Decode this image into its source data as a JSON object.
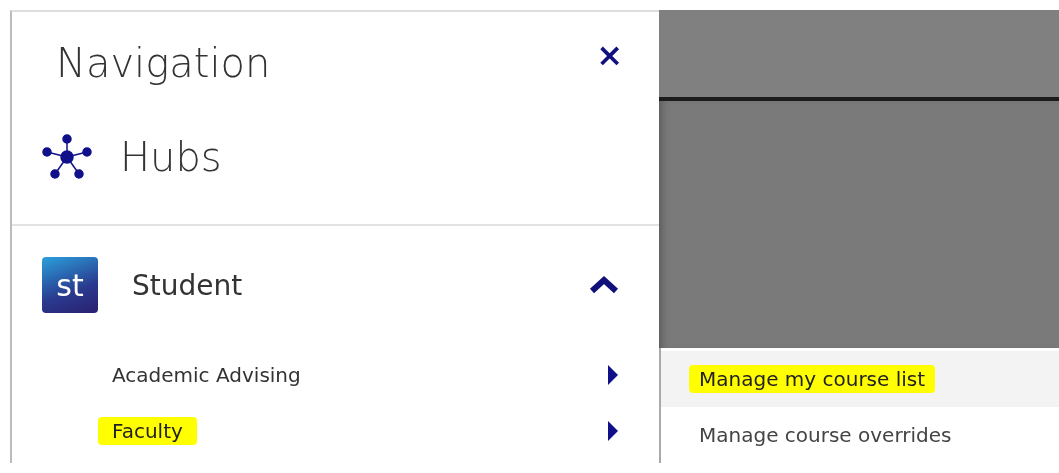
{
  "navigation": {
    "title": "Navigation",
    "close": "×",
    "hubs": {
      "label": "Hubs"
    },
    "section": {
      "badge": "st",
      "label": "Student",
      "expanded": true,
      "items": [
        {
          "label": "Academic Advising",
          "highlighted": false
        },
        {
          "label": "Faculty",
          "highlighted": true
        }
      ]
    }
  },
  "submenu": {
    "items": [
      {
        "label": "Manage my course list",
        "selected": true,
        "highlighted": true
      },
      {
        "label": "Manage course overrides",
        "selected": false,
        "highlighted": false
      }
    ]
  }
}
